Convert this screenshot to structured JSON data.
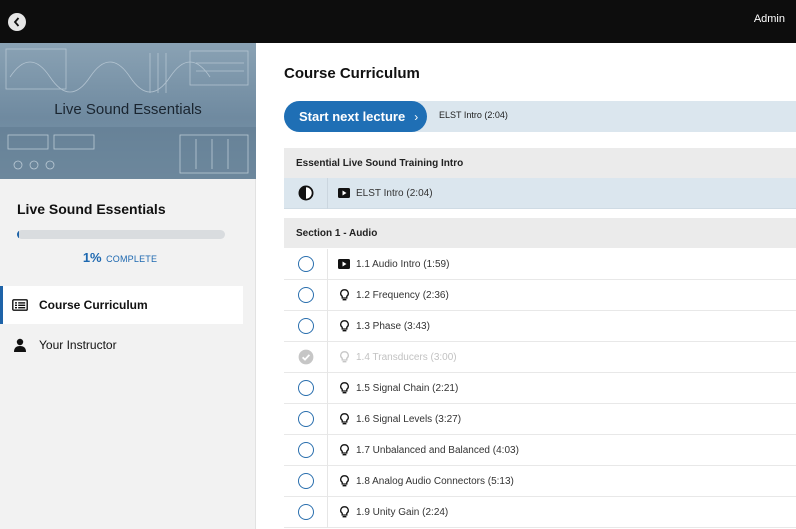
{
  "topbar": {
    "admin_label": "Admin",
    "back_icon": "chevron-left-icon"
  },
  "sidebar": {
    "hero_title": "Live Sound Essentials",
    "course_title": "Live Sound Essentials",
    "progress": {
      "percent": 1,
      "percent_text": "1%",
      "label": "COMPLETE"
    },
    "nav": [
      {
        "label": "Course Curriculum",
        "icon": "curriculum-icon",
        "active": true
      },
      {
        "label": "Your Instructor",
        "icon": "person-icon",
        "active": false
      }
    ]
  },
  "main": {
    "title": "Course Curriculum",
    "next_button_label": "Start next lecture",
    "next_button_chevron": "›",
    "next_lecture": "ELST Intro (2:04)",
    "sections": [
      {
        "title": "Essential Live Sound Training Intro",
        "lectures": [
          {
            "label": "ELST Intro (2:04)",
            "type": "video",
            "status": "in-progress"
          }
        ]
      },
      {
        "title": "Section 1 - Audio",
        "lectures": [
          {
            "label": "1.1 Audio Intro (1:59)",
            "type": "video",
            "status": "not-started"
          },
          {
            "label": "1.2 Frequency (2:36)",
            "type": "lesson",
            "status": "not-started"
          },
          {
            "label": "1.3 Phase (3:43)",
            "type": "lesson",
            "status": "not-started"
          },
          {
            "label": "1.4 Transducers (3:00)",
            "type": "lesson",
            "status": "completed"
          },
          {
            "label": "1.5 Signal Chain (2:21)",
            "type": "lesson",
            "status": "not-started"
          },
          {
            "label": "1.6 Signal Levels (3:27)",
            "type": "lesson",
            "status": "not-started"
          },
          {
            "label": "1.7 Unbalanced and Balanced (4:03)",
            "type": "lesson",
            "status": "not-started"
          },
          {
            "label": "1.8 Analog Audio Connectors (5:13)",
            "type": "lesson",
            "status": "not-started"
          },
          {
            "label": "1.9 Unity Gain (2:24)",
            "type": "lesson",
            "status": "not-started"
          }
        ]
      }
    ]
  },
  "colors": {
    "accent": "#1f6fb5",
    "current_row": "#dbe6ee",
    "section_head": "#ebebeb",
    "topbar": "#0d0d0d"
  }
}
